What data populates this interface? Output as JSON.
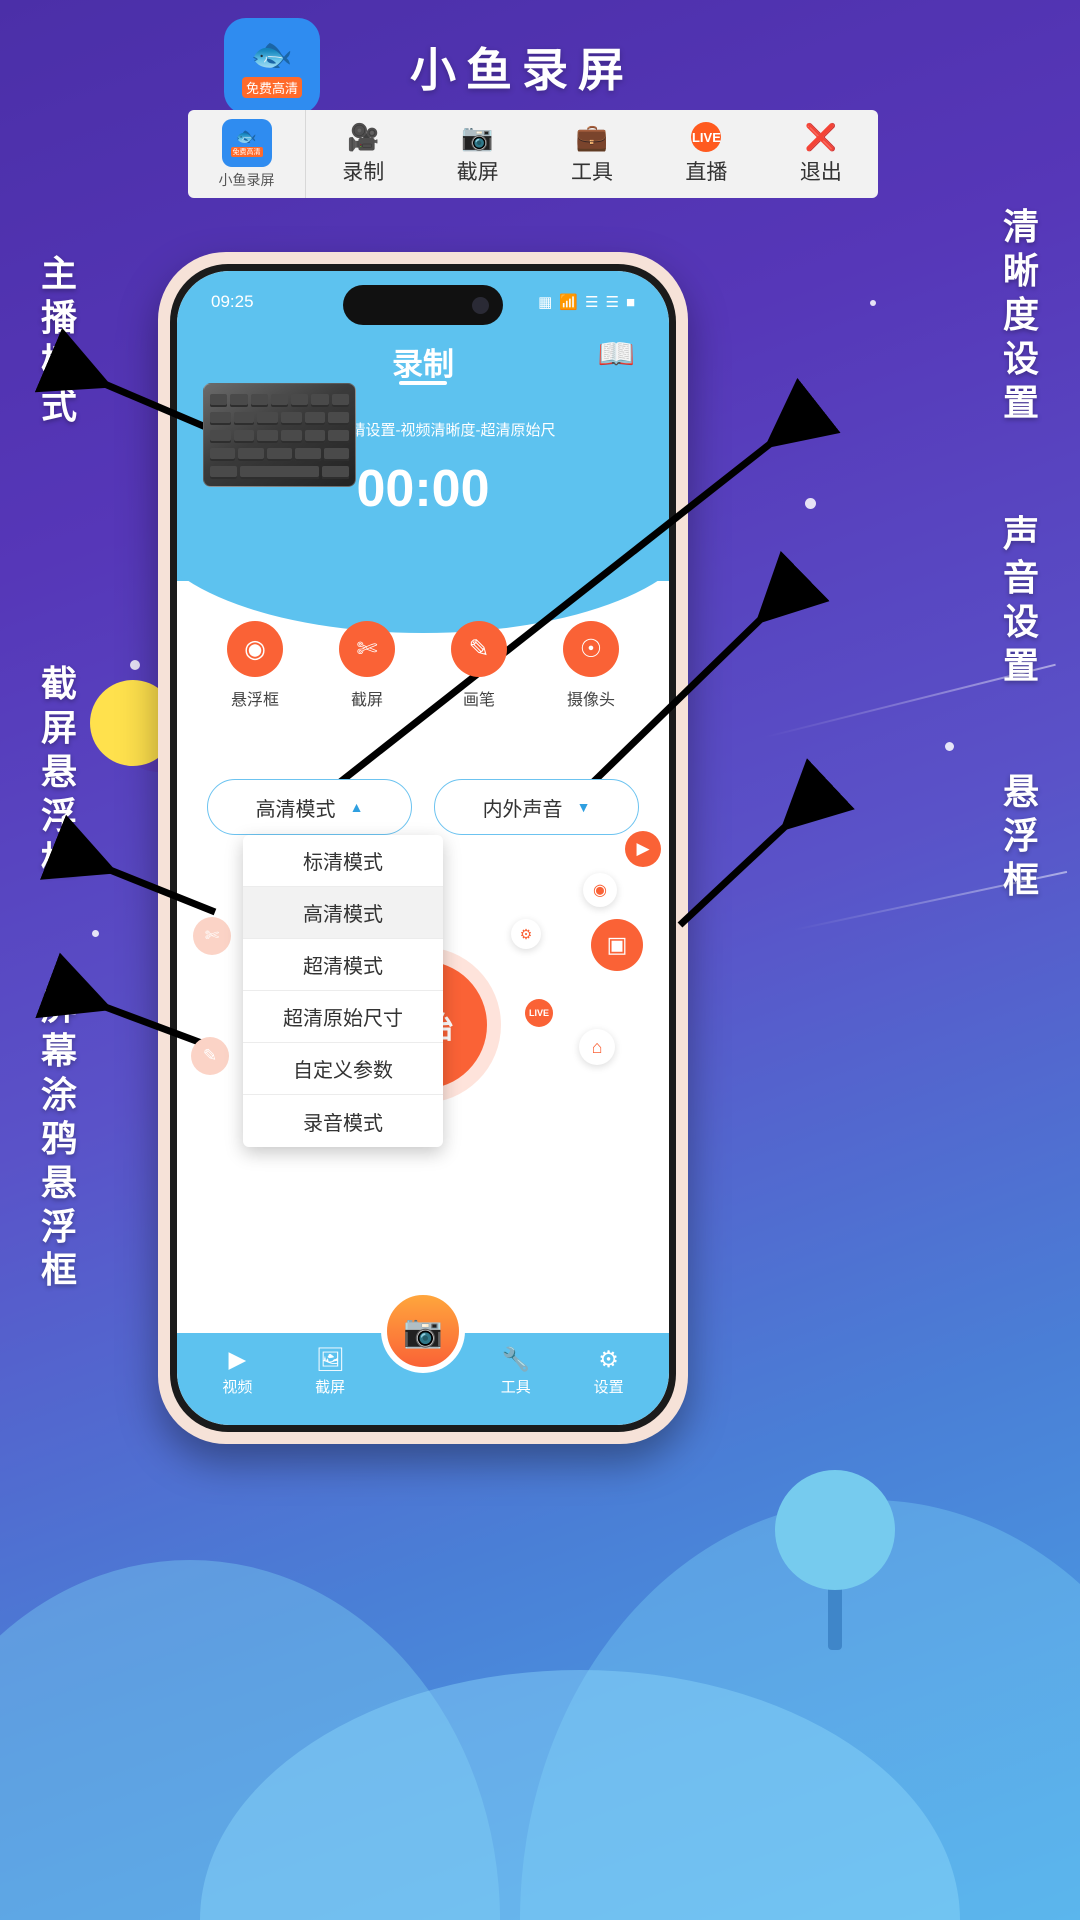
{
  "header": {
    "app_title": "小鱼录屏",
    "logo_badge": "免费高清",
    "logo_icon": "fish-icon"
  },
  "toolbar": {
    "brand_name": "小鱼录屏",
    "brand_badge": "免费高清",
    "items": [
      {
        "label": "录制",
        "icon": "video-camera-icon"
      },
      {
        "label": "截屏",
        "icon": "camera-icon"
      },
      {
        "label": "工具",
        "icon": "toolbox-icon"
      },
      {
        "label": "直播",
        "icon": "live-icon"
      },
      {
        "label": "退出",
        "icon": "close-circle-icon"
      }
    ]
  },
  "phone": {
    "status": {
      "time": "09:25",
      "battery_icon": "battery-icon",
      "wifi_icon": "wifi-icon",
      "signal_icon": "signal-icon",
      "sim_icon": "sim-icon"
    },
    "screen": {
      "title": "录制",
      "book_icon": "book-icon",
      "error_text": "果失败，请设置-视频清晰度-超清原始尺",
      "timer": "00:00",
      "features": [
        {
          "label": "悬浮框",
          "icon": "record-circle-icon"
        },
        {
          "label": "截屏",
          "icon": "scissors-icon"
        },
        {
          "label": "画笔",
          "icon": "pen-icon"
        },
        {
          "label": "摄像头",
          "icon": "camera-head-icon"
        }
      ],
      "quality_select": {
        "value": "高清模式",
        "chevron": "chevron-up-icon"
      },
      "audio_select": {
        "value": "内外声音",
        "chevron": "chevron-down-icon"
      },
      "quality_options": [
        {
          "label": "标清模式",
          "selected": false
        },
        {
          "label": "高清模式",
          "selected": true
        },
        {
          "label": "超清模式",
          "selected": false
        },
        {
          "label": "超清原始尺寸",
          "selected": false
        },
        {
          "label": "自定义参数",
          "selected": false
        },
        {
          "label": "录音模式",
          "selected": false
        }
      ],
      "start_button": "开始",
      "floating_icons": [
        {
          "name": "video-camera-float-icon",
          "glyph": "▶"
        },
        {
          "name": "camera-float-icon",
          "glyph": "◉"
        },
        {
          "name": "toolbox-float-icon",
          "glyph": "⚗"
        },
        {
          "name": "live-float-icon",
          "glyph": "LIVE"
        },
        {
          "name": "screen-record-float-icon",
          "glyph": "⛶"
        },
        {
          "name": "home-float-icon",
          "glyph": "⌂"
        },
        {
          "name": "scissors-ghost-icon",
          "glyph": "✂"
        },
        {
          "name": "pen-ghost-icon",
          "glyph": "✎"
        }
      ],
      "tabs": [
        {
          "label": "视频",
          "icon": "video-tab-icon"
        },
        {
          "label": "截屏",
          "icon": "screenshot-tab-icon"
        },
        {
          "label": "工具",
          "icon": "wrench-tab-icon"
        },
        {
          "label": "设置",
          "icon": "gear-tab-icon"
        }
      ],
      "center_button_icon": "record-button-icon"
    }
  },
  "annotations": {
    "left": [
      {
        "text": "主播模式"
      },
      {
        "text": "截屏悬浮框"
      },
      {
        "text": "屏幕涂鸦悬浮框"
      }
    ],
    "right": [
      {
        "text": "清晰度设置"
      },
      {
        "text": "声音设置"
      },
      {
        "text": "悬浮框"
      }
    ]
  }
}
